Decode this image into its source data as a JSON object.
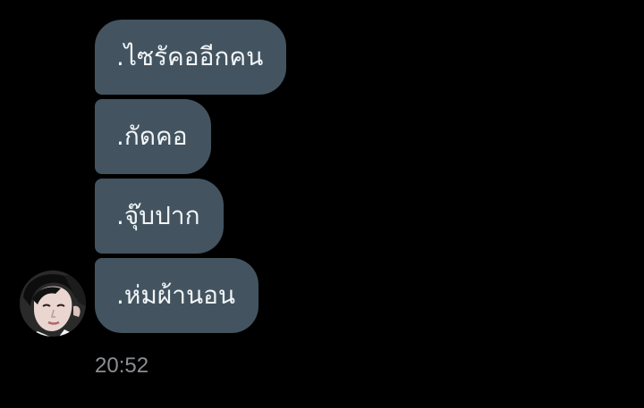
{
  "conversation": {
    "messages": [
      {
        "text": ".ไซรัคออีกคน"
      },
      {
        "text": ".กัดคอ"
      },
      {
        "text": ".จุ๊บปาก"
      },
      {
        "text": ".ห่มผ้านอน"
      }
    ],
    "timestamp": "20:52"
  },
  "colors": {
    "background": "#000000",
    "bubble": "#435460",
    "bubble_text": "#f2f5f7",
    "timestamp_text": "#8a8e92"
  },
  "icons": {
    "avatar": "user-avatar-photo"
  }
}
